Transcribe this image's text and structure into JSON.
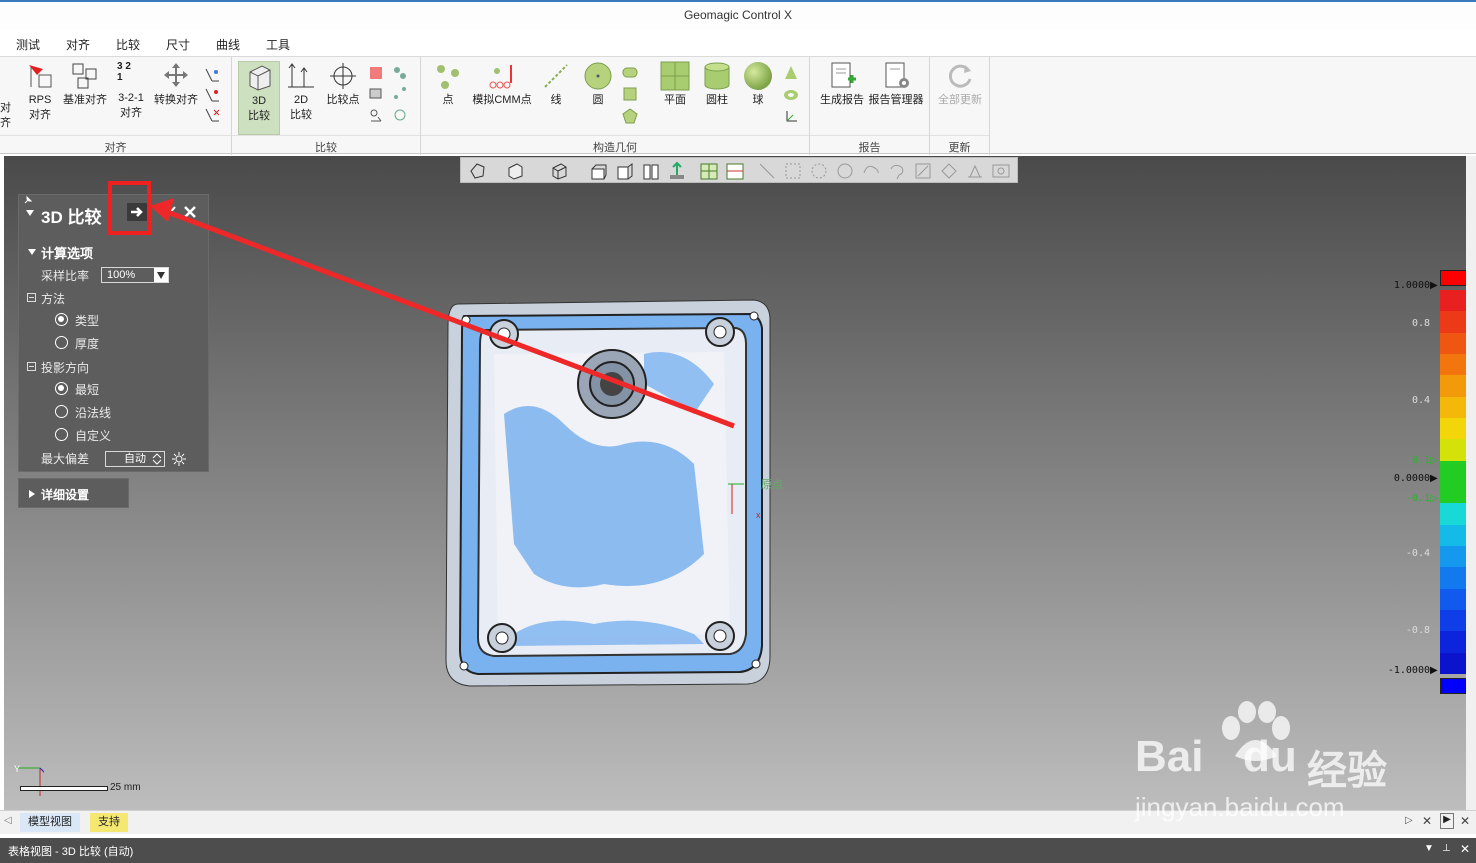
{
  "window": {
    "title": "Geomagic Control X"
  },
  "menu": [
    "测试",
    "对齐",
    "比较",
    "尺寸",
    "曲线",
    "工具"
  ],
  "ribbon": {
    "align_group": {
      "label": "对齐",
      "cut_label": "对齐",
      "rps": "RPS\n对齐",
      "base": "基准对齐",
      "three21": "3-2-1\n对齐",
      "transform": "转换对齐",
      "three21_icon_text": "3 2\n1"
    },
    "compare_group": {
      "label": "比较",
      "compare3d": "3D\n比较",
      "compare2d": "2D\n比较",
      "compare_point": "比较点"
    },
    "geometry_group": {
      "label": "构造几何",
      "point": "点",
      "cmm": "模拟CMM点",
      "line": "线",
      "circle": "圆",
      "plane": "平面",
      "cylinder": "圆柱",
      "sphere": "球"
    },
    "report_group": {
      "label": "报告",
      "generate": "生成报告",
      "manager": "报告管理器"
    },
    "update_group": {
      "label": "更新",
      "update_all": "全部更新"
    }
  },
  "panel": {
    "title": "3D 比较",
    "calc_options": "计算选项",
    "sampling_label": "采样比率",
    "sampling_value": "100%",
    "method_label": "方法",
    "method_options": [
      "类型",
      "厚度"
    ],
    "method_selected": 0,
    "projection_label": "投影方向",
    "projection_options": [
      "最短",
      "沿法线",
      "自定义"
    ],
    "projection_selected": 0,
    "max_dev_label": "最大偏差",
    "max_dev_value": "自动",
    "details": "详细设置"
  },
  "viewport": {
    "origin_label": "原点",
    "axis_x": "x",
    "axis_y": "Y",
    "scale_text": "25 mm"
  },
  "color_scale": {
    "labels": [
      "1.0000",
      "0.8",
      "0.4",
      "0.1",
      "0.0000",
      "-0.1",
      "-0.4",
      "-0.8",
      "-1.0000"
    ],
    "colors": [
      "#e82020",
      "#ec3a18",
      "#ef5612",
      "#f2760d",
      "#f39a0b",
      "#f3b80a",
      "#f2d60a",
      "#d4e20a",
      "#22cc22",
      "#22cc22",
      "#18d8d8",
      "#14bbe8",
      "#1599ee",
      "#1379ee",
      "#115aee",
      "#0f3de8",
      "#0d24dd",
      "#0b14cc"
    ],
    "top_color": "#ff0000",
    "bottom_color": "#0000ff"
  },
  "tabs": [
    "模型视图",
    "支持"
  ],
  "status": {
    "text": "表格视图 - 3D 比较 (自动)"
  },
  "watermark": {
    "brand": "Bai",
    "brand2": "du",
    "chinese": "经验",
    "url": "jingyan.baidu.com"
  }
}
